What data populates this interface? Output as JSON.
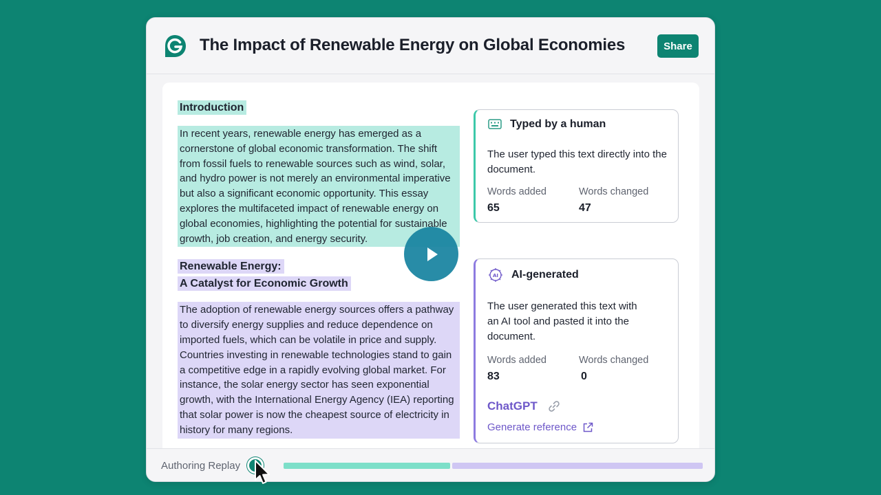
{
  "header": {
    "title": "The Impact of Renewable Energy on Global Economies",
    "share_label": "Share"
  },
  "document": {
    "intro_heading": "Introduction",
    "intro_text": "In recent years, renewable energy has emerged as a cornerstone of global economic transformation. The shift from fossil fuels to renewable sources such as wind, solar, and hydro power is not merely an environmental imperative but also a significant economic opportunity. This essay explores the multifaceted impact of renewable energy on global economies, highlighting the potential for sustainable growth, job creation, and energy security.",
    "section2_heading_line1": "Renewable Energy:",
    "section2_heading_line2": "A Catalyst for Economic Growth",
    "section2_text": "The adoption of renewable energy sources offers a pathway to diversify energy supplies and reduce dependence on imported fuels, which can be volatile in price and supply. Countries investing in renewable technologies stand to gain a competitive edge in a rapidly evolving global market. For instance, the solar energy sector has seen exponential growth, with the International Energy Agency (IEA) reporting that solar power is now the cheapest source of electricity in history for many regions."
  },
  "cards": {
    "human": {
      "icon": "keyboard-icon",
      "title": "Typed by a human",
      "description": "The user typed this text directly into the document.",
      "words_added_label": "Words added",
      "words_added": "65",
      "words_changed_label": "Words changed",
      "words_changed": "47"
    },
    "ai": {
      "icon": "ai-chip-icon",
      "title": "AI-generated",
      "description": "The user generated this text with an AI tool and pasted it into the document.",
      "words_added_label": "Words added",
      "words_added": "83",
      "words_changed_label": "Words changed",
      "words_changed": "0",
      "source": "ChatGPT",
      "generate_reference": "Generate reference"
    }
  },
  "footer": {
    "label": "Authoring Replay",
    "progress_green_fraction": 0.4,
    "progress_purple_fraction": 0.6
  },
  "colors": {
    "brand": "#0d8472",
    "human_highlight": "#b7ebe1",
    "ai_highlight": "#ddd7f7",
    "ai_accent": "#6e58c9"
  }
}
